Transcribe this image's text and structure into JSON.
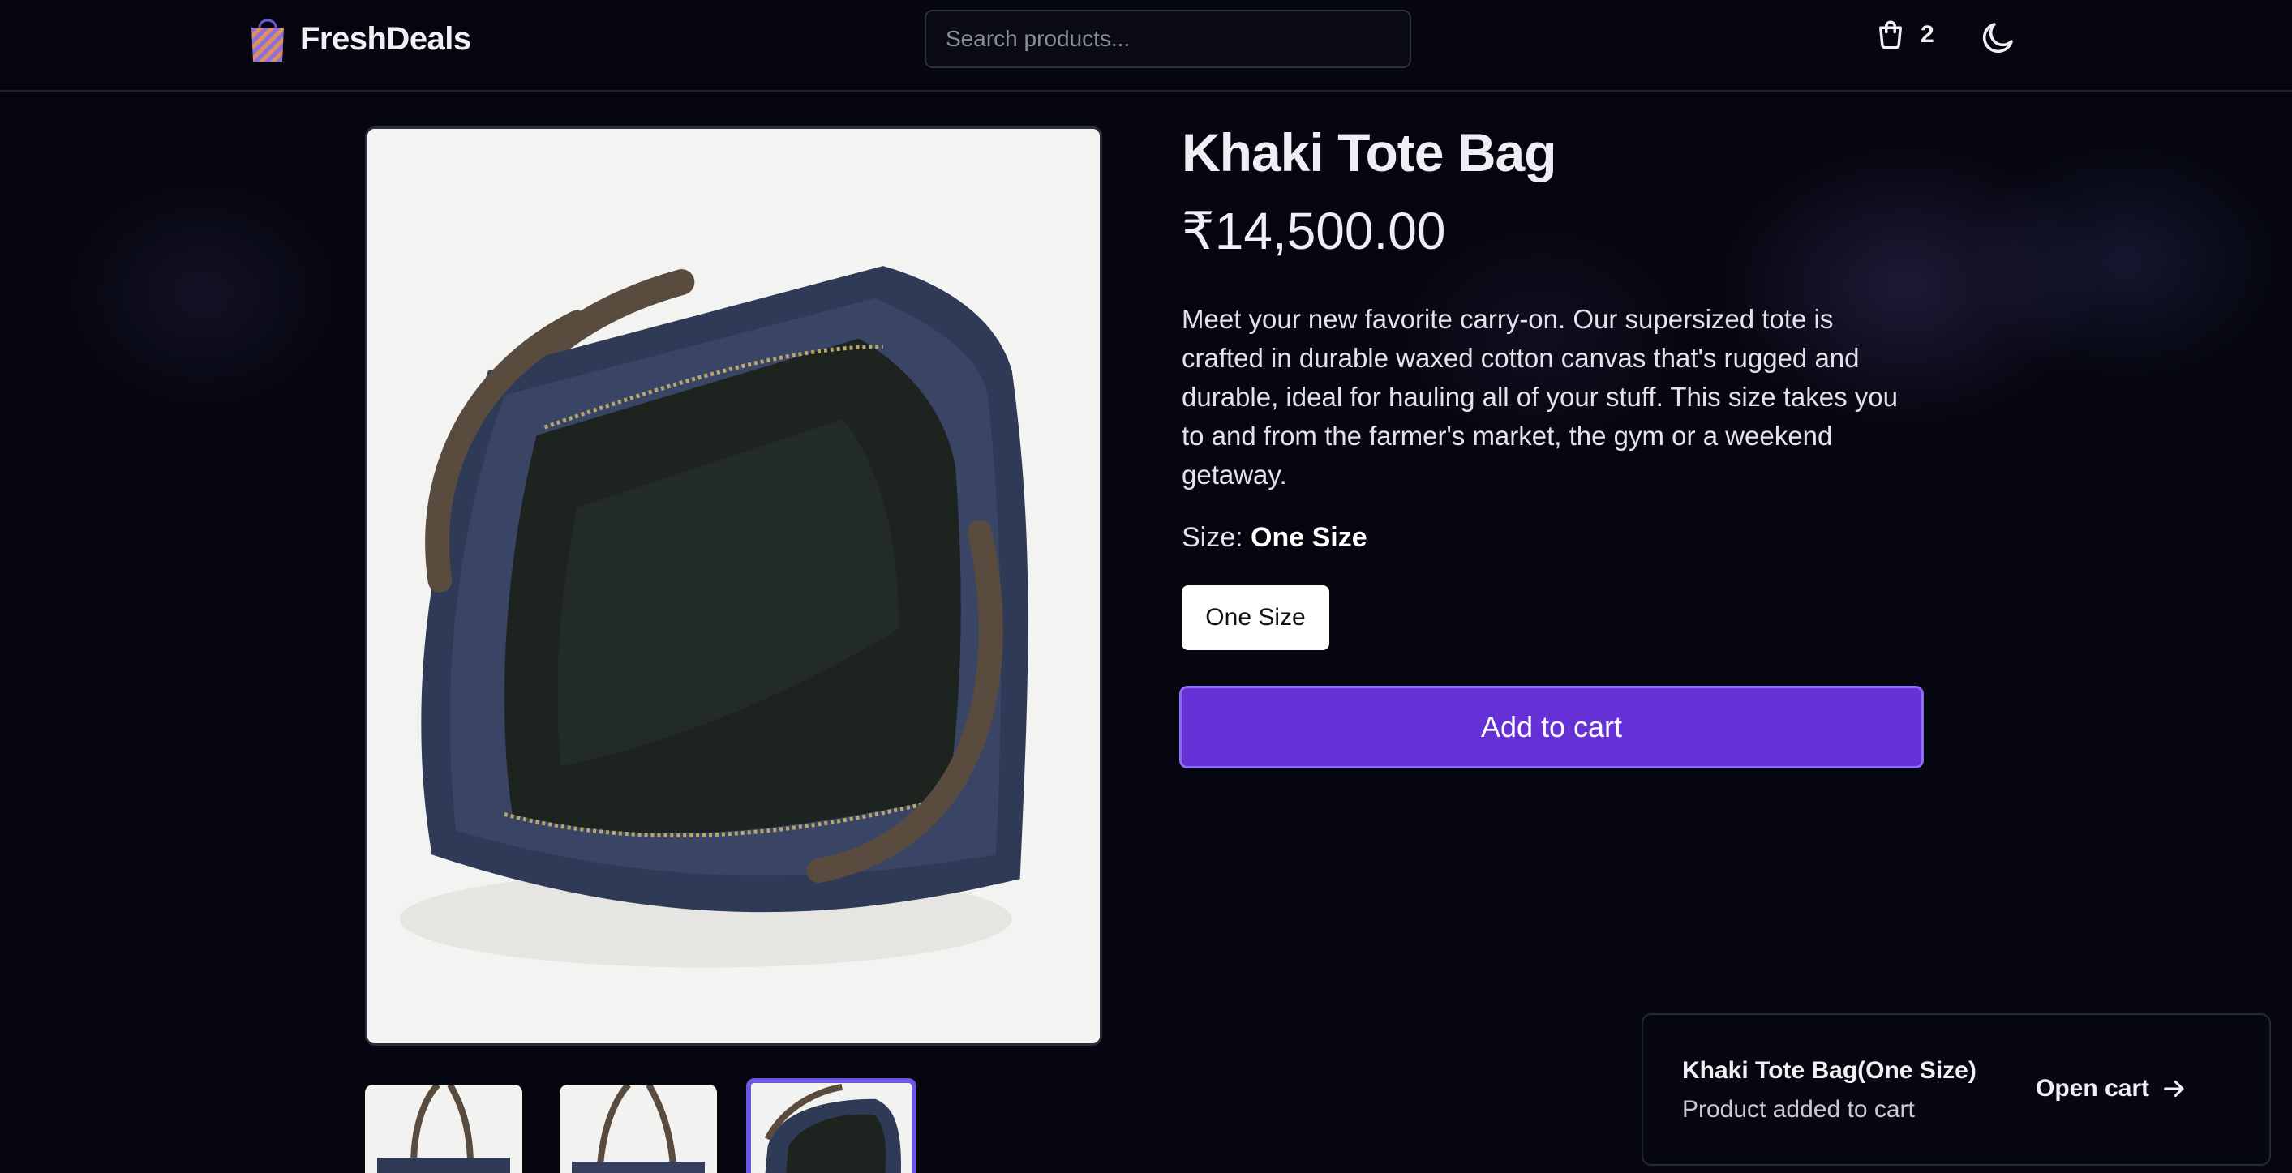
{
  "header": {
    "brand": "FreshDeals",
    "logo_icon": "shopping-bag-icon",
    "search_placeholder": "Search products...",
    "cart_icon": "cart-icon",
    "cart_count": "2",
    "theme_icon": "moon-icon"
  },
  "product": {
    "title": "Khaki Tote Bag",
    "price": "₹14,500.00",
    "description": "Meet your new favorite carry-on. Our supersized tote is crafted in durable waxed cotton canvas that's rugged and durable, ideal for hauling all of your stuff. This size takes you to and from the farmer's market, the gym or a weekend getaway.",
    "size_label": "Size:",
    "size_value": "One Size",
    "size_options": [
      "One Size"
    ],
    "add_to_cart_label": "Add to cart"
  },
  "gallery": {
    "thumbnail_count": 3,
    "selected_thumbnail": 3
  },
  "toast": {
    "title": "Khaki Tote Bag(One Size)",
    "message": "Product added to cart",
    "action_label": "Open cart",
    "action_icon": "arrow-right-icon"
  },
  "colors": {
    "background": "#05060f",
    "accent": "#6530d6",
    "accent_border": "#8c6cf4"
  }
}
